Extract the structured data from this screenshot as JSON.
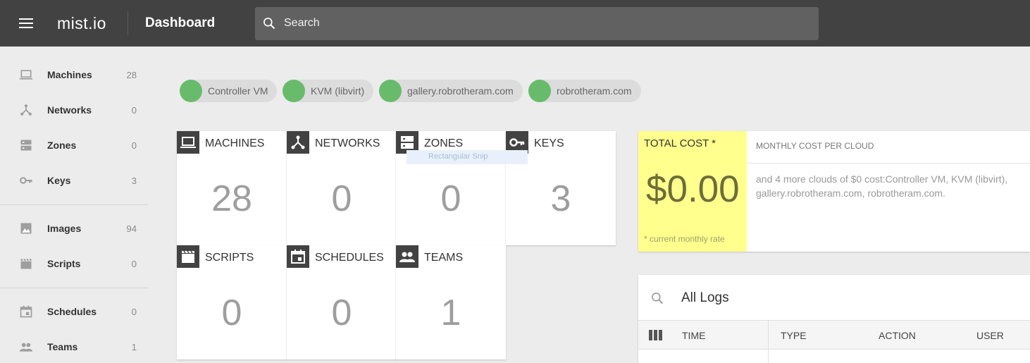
{
  "header": {
    "logo": "mist.io",
    "page_title": "Dashboard",
    "search_placeholder": "Search"
  },
  "sidebar": {
    "items": [
      {
        "label": "Machines",
        "count": "28",
        "icon": "laptop-icon"
      },
      {
        "label": "Networks",
        "count": "0",
        "icon": "network-icon"
      },
      {
        "label": "Zones",
        "count": "0",
        "icon": "dns-icon"
      },
      {
        "label": "Keys",
        "count": "3",
        "icon": "key-icon"
      },
      {
        "label": "Images",
        "count": "94",
        "icon": "image-icon"
      },
      {
        "label": "Scripts",
        "count": "0",
        "icon": "clapperboard-icon"
      },
      {
        "label": "Schedules",
        "count": "0",
        "icon": "calendar-icon"
      },
      {
        "label": "Teams",
        "count": "1",
        "icon": "people-icon"
      }
    ]
  },
  "clouds": [
    {
      "name": "Controller VM",
      "status_color": "#69bb6c"
    },
    {
      "name": "KVM (libvirt)",
      "status_color": "#69bb6c"
    },
    {
      "name": "gallery.robrotheram.com",
      "status_color": "#69bb6c"
    },
    {
      "name": "robrotheram.com",
      "status_color": "#69bb6c"
    }
  ],
  "tiles": [
    {
      "label": "MACHINES",
      "count": "28",
      "icon": "laptop-icon"
    },
    {
      "label": "NETWORKS",
      "count": "0",
      "icon": "network-icon"
    },
    {
      "label": "ZONES",
      "count": "0",
      "icon": "dns-icon"
    },
    {
      "label": "KEYS",
      "count": "3",
      "icon": "key-icon"
    },
    {
      "label": "SCRIPTS",
      "count": "0",
      "icon": "clapperboard-icon"
    },
    {
      "label": "SCHEDULES",
      "count": "0",
      "icon": "calendar-icon"
    },
    {
      "label": "TEAMS",
      "count": "1",
      "icon": "people-icon"
    }
  ],
  "snip_overlay": "Rectangular Snip",
  "cost": {
    "title": "TOTAL COST *",
    "amount": "$0.00",
    "note": "* current monthly rate",
    "monthly_header": "MONTHLY COST PER CLOUD",
    "monthly_text": "and 4 more clouds of $0 cost:Controller VM, KVM (libvirt), gallery.robrotheram.com, robrotheram.com.",
    "highlight_color": "#ffff8d"
  },
  "logs": {
    "title": "All Logs",
    "columns": [
      "TIME",
      "TYPE",
      "ACTION",
      "USER"
    ]
  },
  "colors": {
    "topbar": "#424242",
    "search": "#616161",
    "cloud_online": "#69bb6c"
  }
}
